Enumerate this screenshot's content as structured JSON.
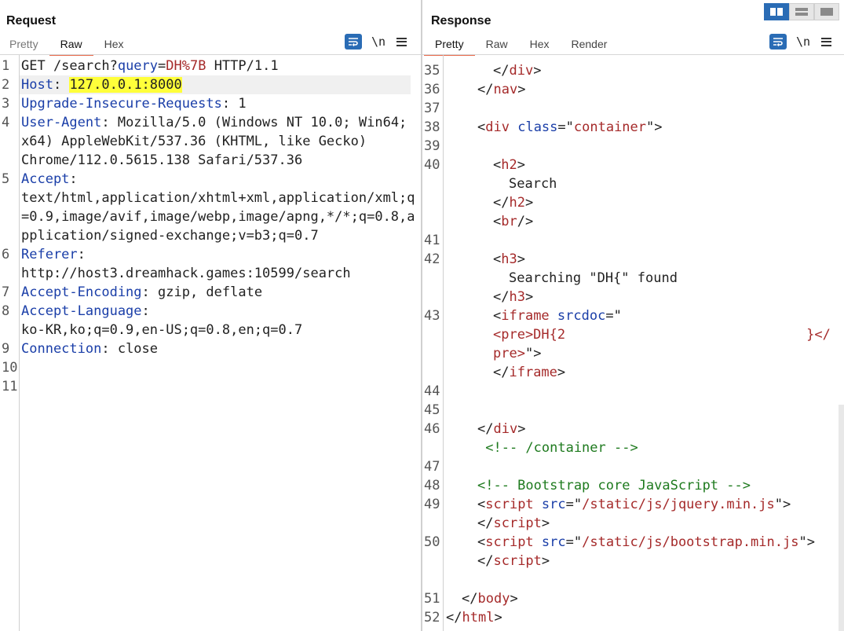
{
  "request": {
    "title": "Request",
    "tabs": [
      "Pretty",
      "Raw",
      "Hex"
    ],
    "active_tab": "Raw",
    "newline_toggle": "\\n",
    "line_numbers": [
      "1",
      "2",
      "3",
      "4",
      "",
      "",
      "5",
      "",
      "",
      "",
      "6",
      "",
      "7",
      "8",
      "",
      "9",
      "10",
      "11"
    ],
    "lines": [
      {
        "parts": [
          [
            "GET /search?",
            ""
          ],
          [
            "query",
            "kw"
          ],
          [
            "=",
            ""
          ],
          [
            "DH%7B",
            "val"
          ],
          [
            " HTTP/1.1",
            ""
          ]
        ]
      },
      {
        "parts": [
          [
            "Host",
            "kw"
          ],
          [
            ": ",
            ""
          ],
          [
            "127.0.0.1:8000",
            "hl"
          ]
        ]
      },
      {
        "parts": [
          [
            "Upgrade-Insecure-Requests",
            "kw"
          ],
          [
            ": 1",
            ""
          ]
        ]
      },
      {
        "parts": [
          [
            "User-Agent",
            "kw"
          ],
          [
            ": Mozilla/5.0 (Windows NT 10.0; Win64;",
            ""
          ]
        ]
      },
      {
        "parts": [
          [
            "x64) AppleWebKit/537.36 (KHTML, like Gecko)",
            ""
          ]
        ]
      },
      {
        "parts": [
          [
            "Chrome/112.0.5615.138 Safari/537.36",
            ""
          ]
        ]
      },
      {
        "parts": [
          [
            "Accept",
            "kw"
          ],
          [
            ":",
            ""
          ]
        ]
      },
      {
        "parts": [
          [
            "text/html,application/xhtml+xml,application/xml;q",
            ""
          ]
        ]
      },
      {
        "parts": [
          [
            "=0.9,image/avif,image/webp,image/apng,*/*;q=0.8,a",
            ""
          ]
        ]
      },
      {
        "parts": [
          [
            "pplication/signed-exchange;v=b3;q=0.7",
            ""
          ]
        ]
      },
      {
        "parts": [
          [
            "Referer",
            "kw"
          ],
          [
            ":",
            ""
          ]
        ]
      },
      {
        "parts": [
          [
            "http://host3.dreamhack.games:10599/search",
            ""
          ]
        ]
      },
      {
        "parts": [
          [
            "Accept-Encoding",
            "kw"
          ],
          [
            ": gzip, deflate",
            ""
          ]
        ]
      },
      {
        "parts": [
          [
            "Accept-Language",
            "kw"
          ],
          [
            ":",
            ""
          ]
        ]
      },
      {
        "parts": [
          [
            "ko-KR,ko;q=0.9,en-US;q=0.8,en;q=0.7",
            ""
          ]
        ]
      },
      {
        "parts": [
          [
            "Connection",
            "kw"
          ],
          [
            ": close",
            ""
          ]
        ]
      },
      {
        "parts": []
      },
      {
        "parts": []
      }
    ]
  },
  "response": {
    "title": "Response",
    "tabs": [
      "Pretty",
      "Raw",
      "Hex",
      "Render"
    ],
    "active_tab": "Pretty",
    "newline_toggle": "\\n",
    "line_numbers": [
      "35",
      "36",
      "37",
      "38",
      "39",
      "40",
      "",
      "",
      "",
      "41",
      "42",
      "",
      "",
      "43",
      "",
      "",
      "",
      "44",
      "45",
      "46",
      "",
      "47",
      "48",
      "49",
      "",
      "50",
      "",
      "",
      "51",
      "52"
    ],
    "lines": [
      {
        "indent": 3,
        "parts": [
          [
            "</",
            ""
          ],
          [
            "div",
            "tag"
          ],
          [
            ">",
            ""
          ]
        ]
      },
      {
        "indent": 2,
        "parts": [
          [
            "</",
            ""
          ],
          [
            "nav",
            "tag"
          ],
          [
            ">",
            ""
          ]
        ]
      },
      {
        "indent": 0,
        "parts": []
      },
      {
        "indent": 2,
        "parts": [
          [
            "<",
            ""
          ],
          [
            "div",
            "tag"
          ],
          [
            " ",
            ""
          ],
          [
            "class",
            "attr"
          ],
          [
            "=\"",
            ""
          ],
          [
            "container",
            "tag"
          ],
          [
            "\">",
            ""
          ]
        ]
      },
      {
        "indent": 0,
        "parts": []
      },
      {
        "indent": 3,
        "parts": [
          [
            "<",
            ""
          ],
          [
            "h2",
            "tag"
          ],
          [
            ">",
            ""
          ]
        ]
      },
      {
        "indent": 4,
        "parts": [
          [
            "Search",
            ""
          ]
        ]
      },
      {
        "indent": 3,
        "parts": [
          [
            "</",
            ""
          ],
          [
            "h2",
            "tag"
          ],
          [
            ">",
            ""
          ]
        ]
      },
      {
        "indent": 3,
        "parts": [
          [
            "<",
            ""
          ],
          [
            "br",
            "tag"
          ],
          [
            "/>",
            ""
          ]
        ]
      },
      {
        "indent": 0,
        "parts": []
      },
      {
        "indent": 3,
        "parts": [
          [
            "<",
            ""
          ],
          [
            "h3",
            "tag"
          ],
          [
            ">",
            ""
          ]
        ]
      },
      {
        "indent": 4,
        "parts": [
          [
            "Searching \"DH{\" found",
            ""
          ]
        ]
      },
      {
        "indent": 3,
        "parts": [
          [
            "</",
            ""
          ],
          [
            "h3",
            "tag"
          ],
          [
            ">",
            ""
          ]
        ]
      },
      {
        "indent": 3,
        "parts": [
          [
            "<",
            ""
          ],
          [
            "iframe",
            "tag"
          ],
          [
            " ",
            ""
          ],
          [
            "srcdoc",
            "attr"
          ],
          [
            "=\"",
            ""
          ]
        ]
      },
      {
        "indent": 3,
        "parts": [
          [
            "<pre>DH{2",
            "tag"
          ],
          [
            "                              ",
            ""
          ],
          [
            "}</",
            "tag"
          ]
        ]
      },
      {
        "indent": 3,
        "parts": [
          [
            "pre>",
            "tag"
          ],
          [
            "\">",
            ""
          ]
        ]
      },
      {
        "indent": 3,
        "parts": [
          [
            "</",
            ""
          ],
          [
            "iframe",
            "tag"
          ],
          [
            ">",
            ""
          ]
        ]
      },
      {
        "indent": 0,
        "parts": []
      },
      {
        "indent": 0,
        "parts": []
      },
      {
        "indent": 2,
        "parts": [
          [
            "</",
            ""
          ],
          [
            "div",
            "tag"
          ],
          [
            ">",
            ""
          ]
        ]
      },
      {
        "indent": 2,
        "parts": [
          [
            " <!-- /container -->",
            "cmt"
          ]
        ]
      },
      {
        "indent": 0,
        "parts": []
      },
      {
        "indent": 2,
        "parts": [
          [
            "<!-- Bootstrap core JavaScript -->",
            "cmt"
          ]
        ]
      },
      {
        "indent": 2,
        "parts": [
          [
            "<",
            ""
          ],
          [
            "script",
            "tag"
          ],
          [
            " ",
            ""
          ],
          [
            "src",
            "attr"
          ],
          [
            "=\"",
            ""
          ],
          [
            "/static/js/jquery.min.js",
            "tag"
          ],
          [
            "\">",
            ""
          ]
        ]
      },
      {
        "indent": 2,
        "parts": [
          [
            "</",
            ""
          ],
          [
            "script",
            "tag"
          ],
          [
            ">",
            ""
          ]
        ]
      },
      {
        "indent": 2,
        "parts": [
          [
            "<",
            ""
          ],
          [
            "script",
            "tag"
          ],
          [
            " ",
            ""
          ],
          [
            "src",
            "attr"
          ],
          [
            "=\"",
            ""
          ],
          [
            "/static/js/bootstrap.min.js",
            "tag"
          ],
          [
            "\">",
            ""
          ]
        ]
      },
      {
        "indent": 2,
        "parts": [
          [
            "</",
            ""
          ],
          [
            "script",
            "tag"
          ],
          [
            ">",
            ""
          ]
        ]
      },
      {
        "indent": 0,
        "parts": []
      },
      {
        "indent": 1,
        "parts": [
          [
            "</",
            ""
          ],
          [
            "body",
            "tag"
          ],
          [
            ">",
            ""
          ]
        ]
      },
      {
        "indent": 0,
        "parts": [
          [
            "</",
            ""
          ],
          [
            "html",
            "tag"
          ],
          [
            ">",
            ""
          ]
        ]
      }
    ]
  }
}
